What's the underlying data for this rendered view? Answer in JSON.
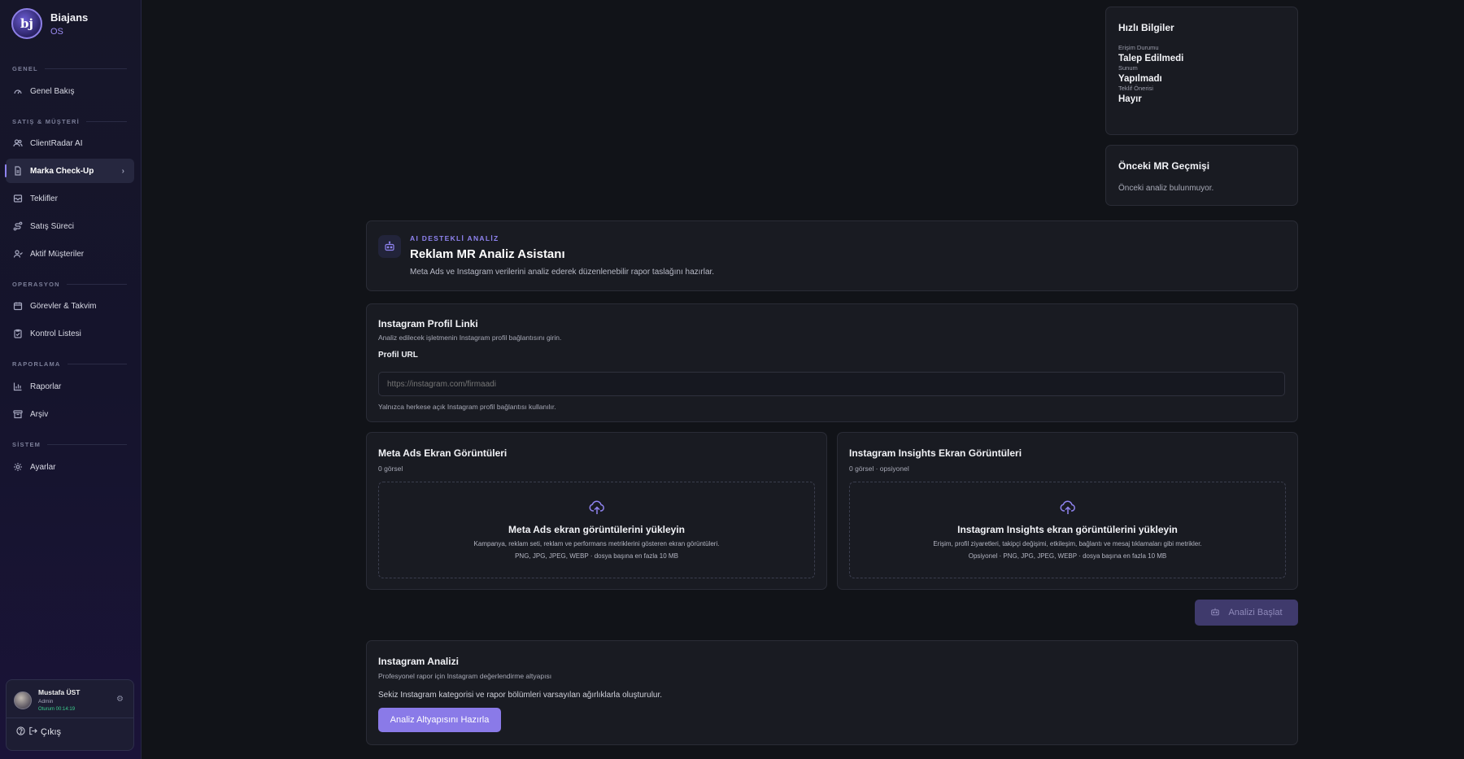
{
  "brand": {
    "name": "Biajans",
    "sub": "OS",
    "logo_text": "bj"
  },
  "sidebar": {
    "sections": [
      {
        "label": "GENEL"
      },
      {
        "label": "SATIŞ & MÜŞTERİ"
      },
      {
        "label": "OPERASYON"
      },
      {
        "label": "RAPORLAMA"
      },
      {
        "label": "SİSTEM"
      }
    ],
    "items": [
      {
        "label": "Genel Bakış",
        "icon": "gauge-icon"
      },
      {
        "label": "ClientRadar AI",
        "icon": "users-icon"
      },
      {
        "label": "Marka Check-Up",
        "icon": "document-icon",
        "active": true
      },
      {
        "label": "Teklifler",
        "icon": "inbox-icon"
      },
      {
        "label": "Satış Süreci",
        "icon": "route-icon"
      },
      {
        "label": "Aktif Müşteriler",
        "icon": "user-check-icon"
      },
      {
        "label": "Görevler & Takvim",
        "icon": "calendar-icon"
      },
      {
        "label": "Kontrol Listesi",
        "icon": "clipboard-icon"
      },
      {
        "label": "Raporlar",
        "icon": "bar-chart-icon"
      },
      {
        "label": "Arşiv",
        "icon": "archive-icon"
      },
      {
        "label": "Ayarlar",
        "icon": "gear-icon"
      }
    ]
  },
  "user": {
    "name": "Mustafa ÜST",
    "role": "Admin",
    "session": "Oturum 00:14:19",
    "logout_label": "Çıkış"
  },
  "quick_info": {
    "title": "Hızlı Bilgiler",
    "rows": [
      {
        "label": "Erişim Durumu",
        "value": "Talep Edilmedi"
      },
      {
        "label": "Sunum",
        "value": "Yapılmadı"
      },
      {
        "label": "Teklif Önerisi",
        "value": "Hayır"
      }
    ]
  },
  "history": {
    "title": "Önceki MR Geçmişi",
    "empty": "Önceki analiz bulunmuyor."
  },
  "assistant": {
    "eyebrow": "AI DESTEKLİ ANALİZ",
    "title": "Reklam MR Analiz Asistanı",
    "description": "Meta Ads ve Instagram verilerini analiz ederek düzenlenebilir rapor taslağını hazırlar."
  },
  "profile": {
    "title": "Instagram Profil Linki",
    "description": "Analiz edilecek işletmenin Instagram profil bağlantısını girin.",
    "field_label": "Profil URL",
    "placeholder": "https://instagram.com/firmaadi",
    "hint": "Yalnızca herkese açık Instagram profil bağlantısı kullanılır."
  },
  "meta_ads": {
    "title": "Meta Ads Ekran Görüntüleri",
    "count": "0 görsel",
    "upload_title": "Meta Ads ekran görüntülerini yükleyin",
    "upload_desc": "Kampanya, reklam seti, reklam ve performans metriklerini gösteren ekran görüntüleri.",
    "upload_note": "PNG, JPG, JPEG, WEBP · dosya başına en fazla 10 MB"
  },
  "insights": {
    "title": "Instagram Insights Ekran Görüntüleri",
    "count": "0 görsel · opsiyonel",
    "upload_title": "Instagram Insights ekran görüntülerini yükleyin",
    "upload_desc": "Erişim, profil ziyaretleri, takipçi değişimi, etkileşim, bağlantı ve mesaj tıklamaları gibi metrikler.",
    "upload_note": "Opsiyonel · PNG, JPG, JPEG, WEBP · dosya başına en fazla 10 MB"
  },
  "start_button": {
    "label": "Analizi Başlat"
  },
  "ig_analysis": {
    "title": "Instagram Analizi",
    "description": "Profesyonel rapor için Instagram değerlendirme altyapısı",
    "info": "Sekiz Instagram kategorisi ve rapor bölümleri varsayılan ağırlıklarla oluşturulur.",
    "button": "Analiz Altyapısını Hazırla"
  },
  "colors": {
    "accent": "#8f83f0",
    "button": "#8a7ae8",
    "background": "#111318",
    "card": "#191b22"
  }
}
